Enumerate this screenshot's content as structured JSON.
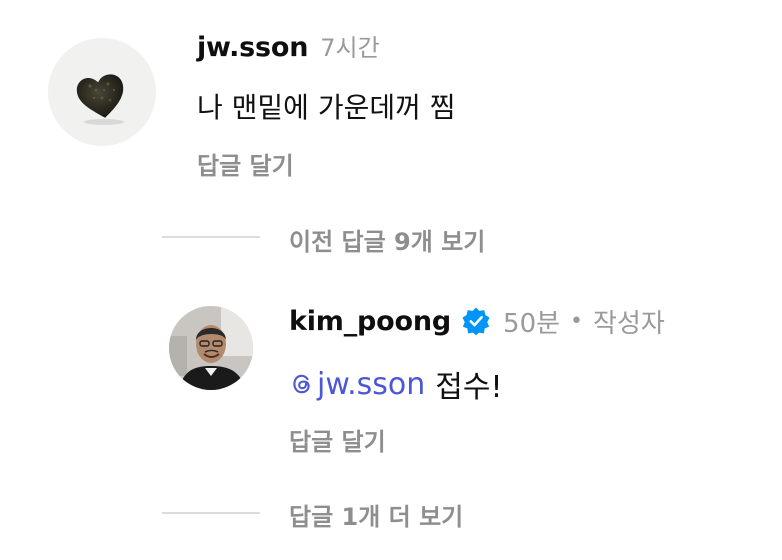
{
  "comment": {
    "username": "jw.sson",
    "time": "7시간",
    "text": "나 맨밑에 가운데꺼 찜",
    "reply_label": "답글 달기"
  },
  "thread": {
    "previous_replies_label": "이전 답글 9개 보기",
    "more_replies_label": "답글 1개 더 보기"
  },
  "reply": {
    "username": "kim_poong",
    "verified_icon": "verified-badge-icon",
    "time": "50분",
    "separator": "•",
    "author_tag": "작성자",
    "mention": "jw.sson",
    "mention_icon": "threads-at-icon",
    "text": "접수!",
    "reply_label": "답글 달기"
  },
  "colors": {
    "mention": "#4b57d6",
    "verified": "#0095f6",
    "muted": "#9a9a9a"
  }
}
